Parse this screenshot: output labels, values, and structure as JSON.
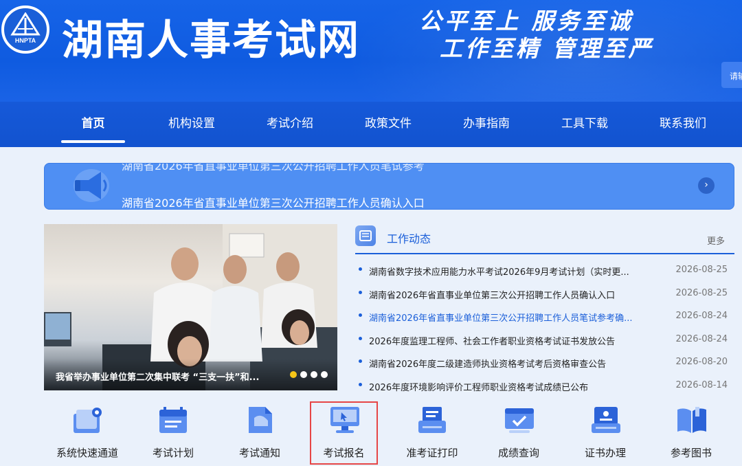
{
  "header": {
    "logo_text": "HNPTA",
    "site_title": "湖南人事考试网",
    "slogan_line1": "公平至上  服务至诚",
    "slogan_line2": "工作至精  管理至严",
    "search_label": "请输"
  },
  "nav": {
    "items": [
      "首页",
      "机构设置",
      "考试介绍",
      "政策文件",
      "办事指南",
      "工具下载",
      "联系我们"
    ],
    "active_index": 0
  },
  "notice": {
    "line_prev": "湖南省2026年省直事业单位第三次公开招聘工作人员笔试参考",
    "line_current": "湖南省2026年省直事业单位第三次公开招聘工作人员确认入口",
    "arrow": "›"
  },
  "carousel": {
    "caption": "我省举办事业单位第二次集中联考 “三支一扶”和...",
    "slides": 4,
    "active_slide": 0
  },
  "news": {
    "title": "工作动态",
    "more": "更多",
    "items": [
      {
        "title": "湖南省数字技术应用能力水平考试2026年9月考试计划（实时更...",
        "date": "2026-08-25"
      },
      {
        "title": "湖南省2026年省直事业单位第三次公开招聘工作人员确认入口",
        "date": "2026-08-25"
      },
      {
        "title": "湖南省2026年省直事业单位第三次公开招聘工作人员笔试参考确...",
        "date": "2026-08-24"
      },
      {
        "title": "2026年度监理工程师、社会工作者职业资格考试证书发放公告",
        "date": "2026-08-24"
      },
      {
        "title": "湖南省2026年度二级建造师执业资格考试考后资格审查公告",
        "date": "2026-08-20"
      },
      {
        "title": "2026年度环境影响评价工程师职业资格考试成绩已公布",
        "date": "2026-08-14"
      }
    ],
    "highlight_index": 2
  },
  "quick_links": {
    "items": [
      {
        "label": "系统快速通道",
        "icon": "gear-folder-icon"
      },
      {
        "label": "考试计划",
        "icon": "calendar-icon"
      },
      {
        "label": "考试通知",
        "icon": "document-icon"
      },
      {
        "label": "考试报名",
        "icon": "monitor-icon"
      },
      {
        "label": "准考证打印",
        "icon": "printer-doc-icon"
      },
      {
        "label": "成绩查询",
        "icon": "check-screen-icon"
      },
      {
        "label": "证书办理",
        "icon": "certificate-icon"
      },
      {
        "label": "参考图书",
        "icon": "book-icon"
      }
    ],
    "selected_index": 3
  },
  "colors": {
    "brand_blue": "#1659d9",
    "accent_yellow": "#f5c518",
    "highlight_red": "#e64545"
  }
}
